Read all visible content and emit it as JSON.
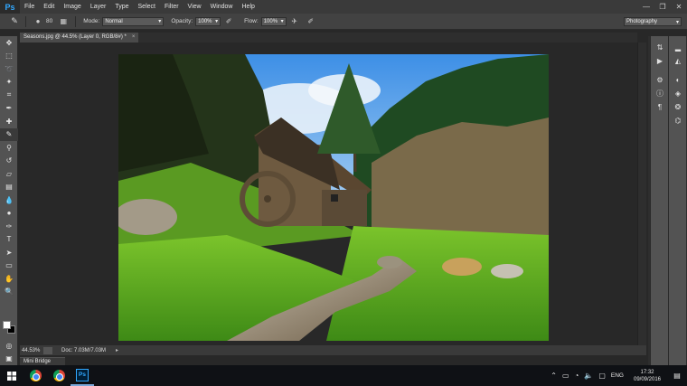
{
  "app": {
    "logo": "Ps"
  },
  "menu": [
    "File",
    "Edit",
    "Image",
    "Layer",
    "Type",
    "Select",
    "Filter",
    "View",
    "Window",
    "Help"
  ],
  "window_controls": {
    "minimize": "—",
    "restore": "❐",
    "close": "✕"
  },
  "options_bar": {
    "brush_size": "80",
    "mode_label": "Mode:",
    "mode_value": "Normal",
    "opacity_label": "Opacity:",
    "opacity_value": "100%",
    "flow_label": "Flow:",
    "flow_value": "100%",
    "workspace": "Photography"
  },
  "document": {
    "tab_title": "Seasons.jpg @ 44.5% (Layer 0, RGB/8#) *",
    "close": "×"
  },
  "status": {
    "zoom": "44.53%",
    "doc_info": "Doc: 7.03M/7.03M",
    "arrow": "▸"
  },
  "mini_bridge": "Mini Bridge",
  "colors": {
    "foreground": "#ffffff",
    "background": "#000000",
    "accent": "#31a8ff"
  },
  "tools": [
    "move-icon",
    "marquee-icon",
    "lasso-icon",
    "quick-select-icon",
    "crop-icon",
    "eyedropper-icon",
    "healing-icon",
    "brush-icon",
    "clone-stamp-icon",
    "history-brush-icon",
    "eraser-icon",
    "gradient-icon",
    "blur-icon",
    "dodge-icon",
    "pen-icon",
    "type-icon",
    "path-select-icon",
    "shape-icon",
    "hand-icon",
    "zoom-icon"
  ],
  "taskbar": {
    "tray_lang": "ENG",
    "time": "17:32",
    "date": "09/09/2016"
  }
}
